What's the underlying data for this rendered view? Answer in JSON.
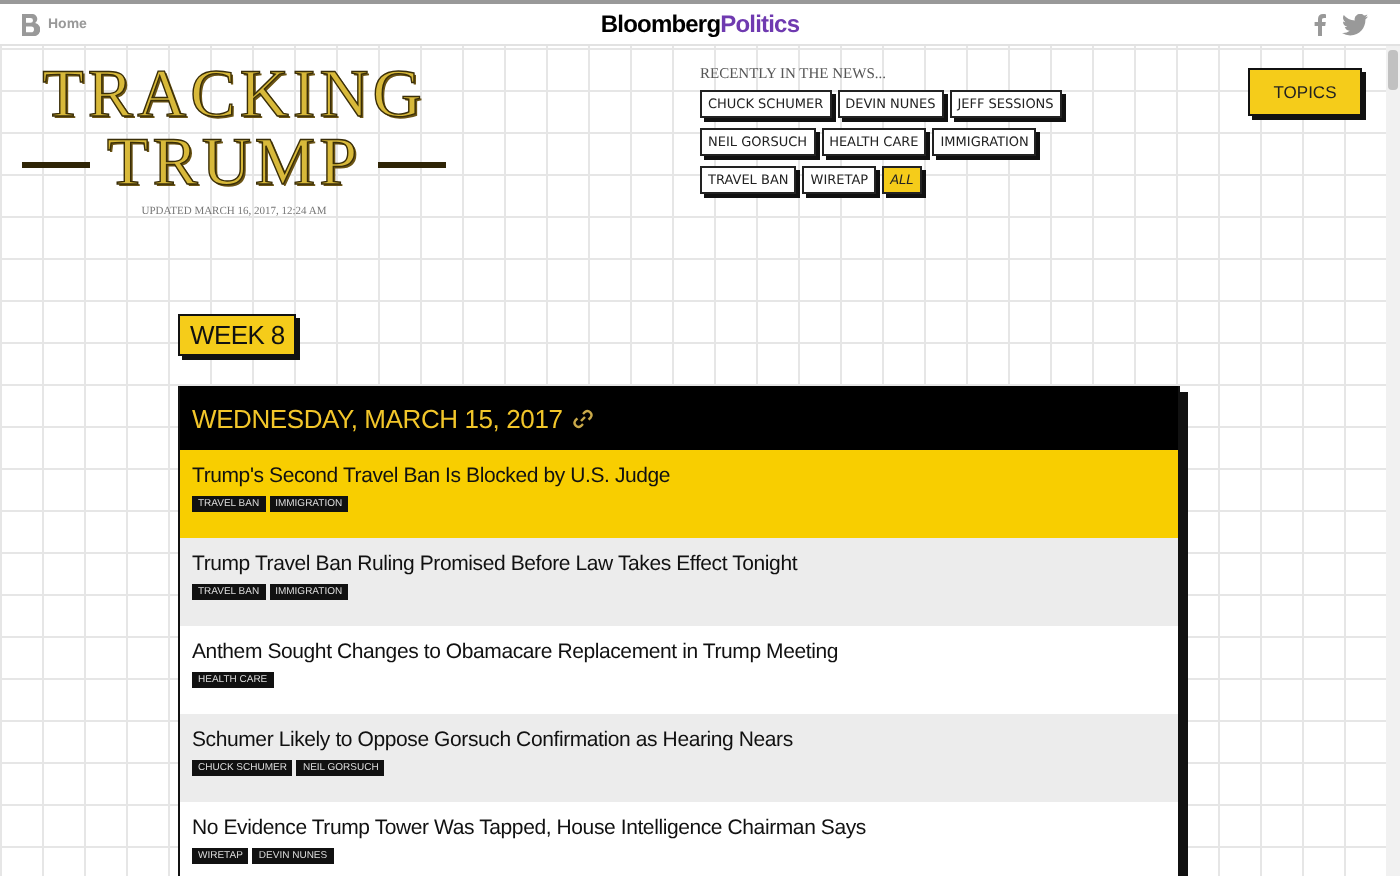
{
  "topbar": {
    "home": "Home",
    "brand": "Bloomberg",
    "brand_section": "Politics"
  },
  "logo": {
    "line_1": "TRACKING",
    "line_2": "TRUMP",
    "updated": "UPDATED MARCH 16, 2017, 12:24 AM"
  },
  "news": {
    "heading": "RECENTLY IN THE NEWS...",
    "tags": [
      {
        "label": "CHUCK SCHUMER",
        "selected": false
      },
      {
        "label": "DEVIN NUNES",
        "selected": false
      },
      {
        "label": "JEFF SESSIONS",
        "selected": false
      },
      {
        "label": "NEIL GORSUCH",
        "selected": false
      },
      {
        "label": "HEALTH CARE",
        "selected": false
      },
      {
        "label": "IMMIGRATION",
        "selected": false
      },
      {
        "label": "TRAVEL BAN",
        "selected": false
      },
      {
        "label": "WIRETAP",
        "selected": false
      },
      {
        "label": "ALL",
        "selected": true
      }
    ]
  },
  "topics_button": "TOPICS",
  "week": "WEEK 8",
  "day": {
    "date": "WEDNESDAY, MARCH 15, 2017",
    "articles": [
      {
        "title": "Trump's Second Travel Ban Is Blocked by U.S. Judge",
        "highlighted": true,
        "tags": [
          "TRAVEL BAN",
          "IMMIGRATION"
        ]
      },
      {
        "title": "Trump Travel Ban Ruling Promised Before Law Takes Effect Tonight",
        "highlighted": false,
        "tags": [
          "TRAVEL BAN",
          "IMMIGRATION"
        ]
      },
      {
        "title": "Anthem Sought Changes to Obamacare Replacement in Trump Meeting",
        "highlighted": false,
        "tags": [
          "HEALTH CARE"
        ]
      },
      {
        "title": "Schumer Likely to Oppose Gorsuch Confirmation as Hearing Nears",
        "highlighted": false,
        "tags": [
          "CHUCK SCHUMER",
          "NEIL GORSUCH"
        ]
      },
      {
        "title": "No Evidence Trump Tower Was Tapped, House Intelligence Chairman Says",
        "highlighted": false,
        "tags": [
          "WIRETAP",
          "DEVIN NUNES"
        ]
      }
    ]
  }
}
